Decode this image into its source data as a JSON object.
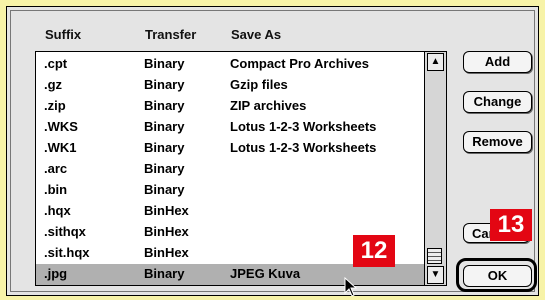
{
  "columns": {
    "suffix": "Suffix",
    "transfer": "Transfer",
    "save_as": "Save As"
  },
  "rows": [
    {
      "suffix": ".cpt",
      "transfer": "Binary",
      "save_as": "Compact Pro Archives"
    },
    {
      "suffix": ".gz",
      "transfer": "Binary",
      "save_as": "Gzip files"
    },
    {
      "suffix": ".zip",
      "transfer": "Binary",
      "save_as": "ZIP archives"
    },
    {
      "suffix": ".WKS",
      "transfer": "Binary",
      "save_as": "Lotus 1-2-3 Worksheets"
    },
    {
      "suffix": ".WK1",
      "transfer": "Binary",
      "save_as": "Lotus 1-2-3 Worksheets"
    },
    {
      "suffix": ".arc",
      "transfer": "Binary",
      "save_as": ""
    },
    {
      "suffix": ".bin",
      "transfer": "Binary",
      "save_as": ""
    },
    {
      "suffix": ".hqx",
      "transfer": "BinHex",
      "save_as": ""
    },
    {
      "suffix": ".sithqx",
      "transfer": "BinHex",
      "save_as": ""
    },
    {
      "suffix": ".sit.hqx",
      "transfer": "BinHex",
      "save_as": ""
    },
    {
      "suffix": ".jpg",
      "transfer": "Binary",
      "save_as": "JPEG Kuva"
    }
  ],
  "selected_row": 10,
  "buttons": {
    "add": "Add",
    "change": "Change",
    "remove": "Remove",
    "cancel": "Car",
    "ok": "OK"
  },
  "callouts": {
    "list": "12",
    "ok": "13"
  },
  "colors": {
    "callout": "#e30613",
    "background": "#f7f3a8",
    "selection": "#b0b0b0"
  }
}
